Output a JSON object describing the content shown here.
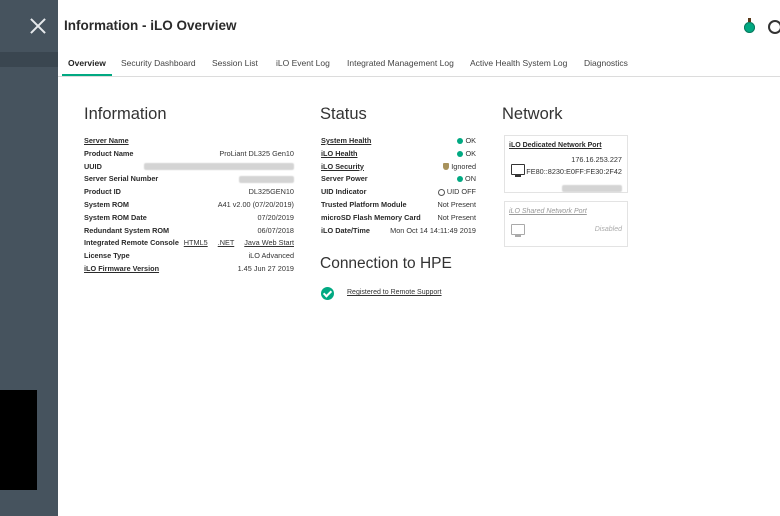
{
  "header": {
    "title": "Information - iLO Overview"
  },
  "tabs": [
    {
      "label": "Overview"
    },
    {
      "label": "Security Dashboard"
    },
    {
      "label": "Session List"
    },
    {
      "label": "iLO Event Log"
    },
    {
      "label": "Integrated Management Log"
    },
    {
      "label": "Active Health System Log"
    },
    {
      "label": "Diagnostics"
    }
  ],
  "information": {
    "title": "Information",
    "server_name": "Server Name",
    "product_name_label": "Product Name",
    "product_name_value": "ProLiant DL325 Gen10",
    "uuid_label": "UUID",
    "serial_label": "Server Serial Number",
    "product_id_label": "Product ID",
    "product_id_value": "DL325GEN10",
    "rom_label": "System ROM",
    "rom_value": "A41 v2.00 (07/20/2019)",
    "rom_date_label": "System ROM Date",
    "rom_date_value": "07/20/2019",
    "redundant_label": "Redundant System ROM",
    "redundant_value": "06/07/2018",
    "console_label": "Integrated Remote Console",
    "console_links": [
      "HTML5",
      ".NET",
      "Java Web Start"
    ],
    "license_label": "License Type",
    "license_value": "iLO Advanced",
    "firmware_label": "iLO Firmware Version",
    "firmware_value": "1.45 Jun 27 2019"
  },
  "status": {
    "title": "Status",
    "system_health_label": "System Health",
    "system_health_value": "OK",
    "ilo_health_label": "iLO Health",
    "ilo_health_value": "OK",
    "ilo_security_label": "iLO Security",
    "ilo_security_value": "Ignored",
    "server_power_label": "Server Power",
    "server_power_value": "ON",
    "uid_label": "UID Indicator",
    "uid_value": "UID OFF",
    "tpm_label": "Trusted Platform Module",
    "tpm_value": "Not Present",
    "sd_label": "microSD Flash Memory Card",
    "sd_value": "Not Present",
    "date_label": "iLO Date/Time",
    "date_value": "Mon Oct 14 14:11:49 2019"
  },
  "connection": {
    "title": "Connection to HPE",
    "link": "Registered to Remote Support"
  },
  "network": {
    "title": "Network",
    "dedicated_title": "iLO Dedicated Network Port",
    "dedicated_ip": "176.16.253.227",
    "dedicated_ipv6": "FE80::8230:E0FF:FE30:2F42",
    "shared_title": "iLO Shared Network Port",
    "shared_status": "Disabled"
  },
  "colors": {
    "accent": "#01a982",
    "sidebar": "#46535e"
  }
}
